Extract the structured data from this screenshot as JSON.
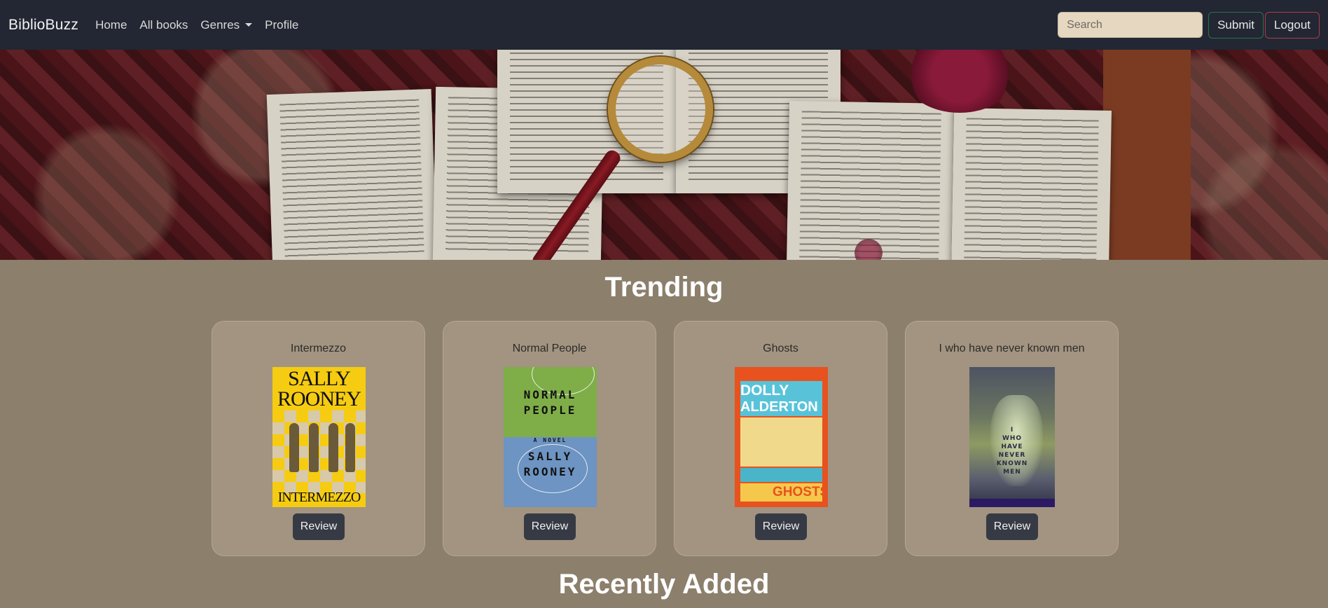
{
  "navbar": {
    "brand": "BiblioBuzz",
    "links": [
      "Home",
      "All books",
      "Genres",
      "Profile"
    ],
    "search_placeholder": "Search",
    "submit_label": "Submit",
    "logout_label": "Logout"
  },
  "trending": {
    "title": "Trending",
    "books": [
      {
        "title": "Intermezzo",
        "cover_text": [
          "SALLY",
          "ROONEY",
          "INTERMEZZO"
        ],
        "review_label": "Review"
      },
      {
        "title": "Normal People",
        "cover_text": [
          "NORMAL",
          "PEOPLE",
          "A NOVEL",
          "SALLY",
          "ROONEY"
        ],
        "review_label": "Review"
      },
      {
        "title": "Ghosts",
        "cover_text": [
          "DOLLY",
          "ALDERTON",
          "GHOSTS"
        ],
        "review_label": "Review"
      },
      {
        "title": "I who have never known men",
        "cover_text": [
          "I",
          "WHO",
          "HAVE",
          "NEVER",
          "KNOWN",
          "MEN"
        ],
        "review_label": "Review"
      }
    ]
  },
  "recently_added": {
    "title": "Recently Added"
  },
  "colors": {
    "navbar_bg": "#222733",
    "page_bg": "#8c7f6c",
    "card_bg": "#a29480",
    "review_button": "#363a44",
    "submit_border": "#2e6f48",
    "logout_border": "#b23a48"
  },
  "icons": [
    "caret-down-icon",
    "chevron-left-icon",
    "chevron-right-icon"
  ]
}
